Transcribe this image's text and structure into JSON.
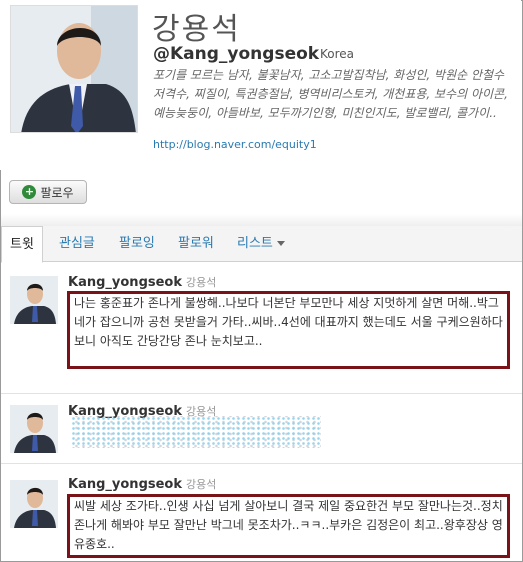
{
  "profile": {
    "name": "강용석",
    "handle": "@Kang_yongseok",
    "location": "Korea",
    "bio": "포기를 모르는 남자, 불꽃남자, 고소고발집착남, 화성인, 박원순 안철수 저격수, 찌질이, 특권층절남, 병역비리스토커, 개천표용, 보수의 아이콘, 예능늦둥이, 아들바보, 모두까기인형, 미친인지도, 발로밸리, 콜가이..",
    "url": "http://blog.naver.com/equity1"
  },
  "follow_button": {
    "label": "팔로우",
    "icon": "plus-circle-icon"
  },
  "tabs": [
    {
      "label": "트윗",
      "active": true
    },
    {
      "label": "관심글",
      "active": false
    },
    {
      "label": "팔로잉",
      "active": false
    },
    {
      "label": "팔로워",
      "active": false
    },
    {
      "label": "리스트",
      "active": false,
      "dropdown": true
    }
  ],
  "tweets": [
    {
      "author": "Kang_yongseok",
      "author_kr": "강용석",
      "text": "나는 홍준표가 존나게 불쌍해..나보다 너본단 부모만나 세상 지멋하게 살면 머해..박그네가 잡으니까 공천 못받을거 가타..씨바..4선에 대표까지 했는데도 서울 구케으원하다보니 아직도 간당간당 존나 눈치보고..",
      "highlighted": true,
      "redacted": false
    },
    {
      "author": "Kang_yongseok",
      "author_kr": "강용석",
      "text": "",
      "highlighted": false,
      "redacted": true
    },
    {
      "author": "Kang_yongseok",
      "author_kr": "강용석",
      "text": "씨발 세상 조가타..인생 사십 넘게 살아보니 결국 제일 중요한건 부모 잘만나는것..정치 존나게 해봐야 부모 잘만난 박그네 못조차가..ㅋㅋ..부카은 김정은이 최고..왕후장상 영유종호..",
      "highlighted": true,
      "redacted": false
    }
  ],
  "colors": {
    "link": "#2a7ab0",
    "highlight_border": "#7a1318",
    "follow_icon": "#2f8a3a"
  }
}
